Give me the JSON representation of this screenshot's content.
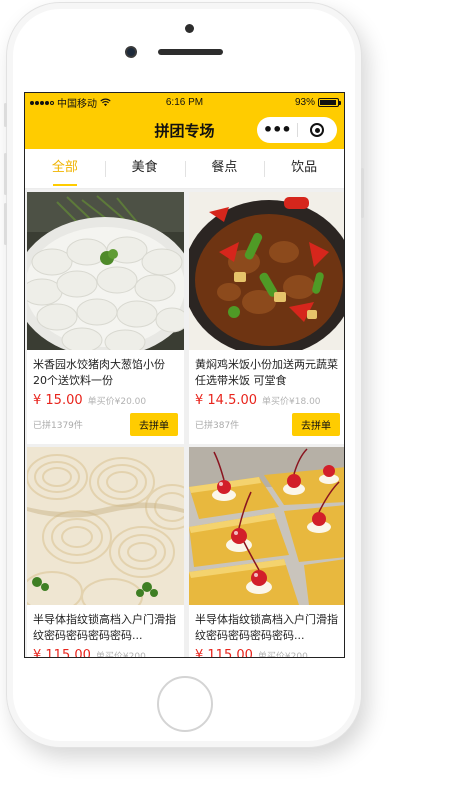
{
  "status_bar": {
    "carrier": "中国移动",
    "time": "6:16 PM",
    "battery": "93%",
    "battery_level": 0.93,
    "signal_bars": 4,
    "signal_icon": "signal-dots-icon",
    "wifi_icon": "wifi-icon",
    "battery_icon": "battery-icon"
  },
  "nav": {
    "title": "拼团专场",
    "more_icon": "more-dots-icon",
    "close_icon": "target-close-icon"
  },
  "tabs": [
    {
      "label": "全部",
      "active": true
    },
    {
      "label": "美食",
      "active": false
    },
    {
      "label": "餐点",
      "active": false
    },
    {
      "label": "饮品",
      "active": false
    }
  ],
  "products": [
    {
      "title": "米香园水饺猪肉大葱馅小份20个送饮料一份",
      "price": "¥ 15.00",
      "original_price": "单买价¥20.00",
      "sold": "已拼1379件",
      "button": "去拼单",
      "image": "dumplings-photo"
    },
    {
      "title": "黄焖鸡米饭小份加送两元蔬菜任选带米饭 可堂食",
      "price": "¥ 14.5.00",
      "original_price": "单买价¥18.00",
      "sold": "已拼387件",
      "button": "去拼单",
      "image": "braised-chicken-photo"
    },
    {
      "title": "半导体指纹锁高档入户门滑指纹密码密码密码密码...",
      "price": "¥ 115.00",
      "original_price": "单买价¥200",
      "sold": "",
      "button": "",
      "image": "noodles-photo"
    },
    {
      "title": "半导体指纹锁高档入户门滑指纹密码密码密码密码...",
      "price": "¥ 115.00",
      "original_price": "单买价¥200",
      "sold": "",
      "button": "",
      "image": "cherry-cake-photo"
    }
  ],
  "colors": {
    "accent": "#ffcc00",
    "price": "#e8241c",
    "active_tab_text": "#f0b400"
  }
}
